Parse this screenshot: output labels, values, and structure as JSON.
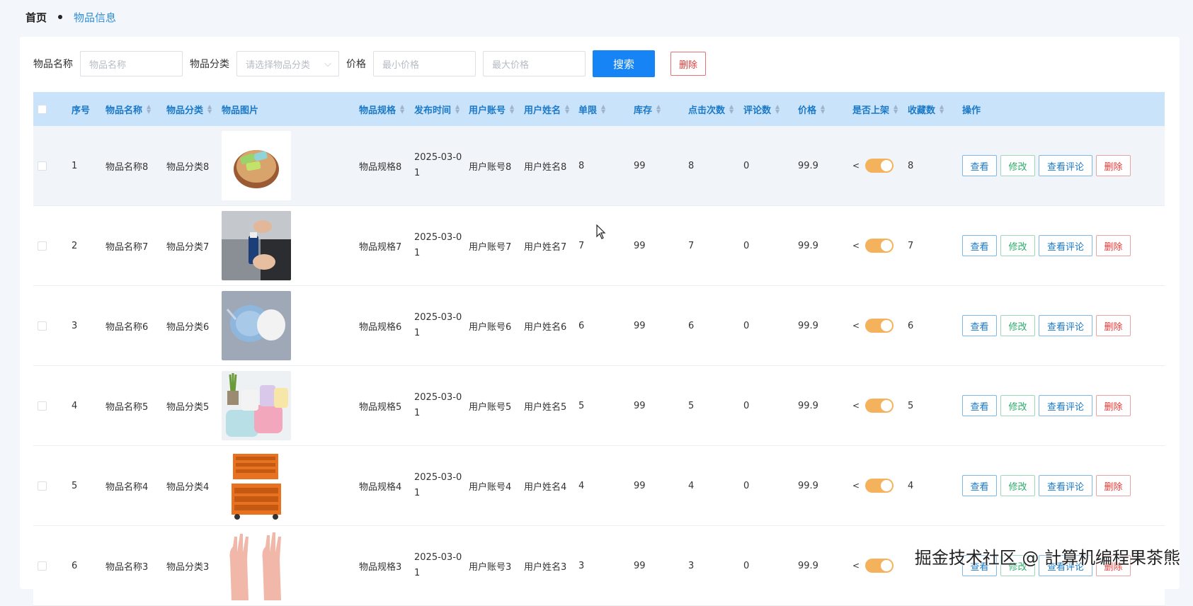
{
  "breadcrumb": {
    "home": "首页",
    "current": "物品信息"
  },
  "search": {
    "name_label": "物品名称",
    "name_placeholder": "物品名称",
    "category_label": "物品分类",
    "category_placeholder": "请选择物品分类",
    "price_label": "价格",
    "min_placeholder": "最小价格",
    "max_placeholder": "最大价格",
    "search_button": "搜索",
    "delete_button": "删除"
  },
  "table": {
    "headers": {
      "index": "序号",
      "name": "物品名称",
      "category": "物品分类",
      "image": "物品图片",
      "spec": "物品规格",
      "publish_time": "发布时间",
      "account": "用户账号",
      "username": "用户姓名",
      "limit": "单限",
      "stock": "库存",
      "clicks": "点击次数",
      "comments": "评论数",
      "price": "价格",
      "on_sale": "是否上架",
      "favorites": "收藏数",
      "actions": "操作"
    },
    "actions": {
      "view": "查看",
      "edit": "修改",
      "review": "查看评论",
      "delete": "删除"
    },
    "rows": [
      {
        "index": "1",
        "name": "物品名称8",
        "category": "物品分类8",
        "image": "wood-slice-soap",
        "spec": "物品规格8",
        "date_a": "2025-03-0",
        "date_b": "1",
        "account": "用户账号8",
        "username": "用户姓名8",
        "limit": "8",
        "stock": "99",
        "clicks": "8",
        "comments": "0",
        "price": "99.9",
        "on_sale": true,
        "favorites": "8"
      },
      {
        "index": "2",
        "name": "物品名称7",
        "category": "物品分类7",
        "image": "car-cleaning",
        "spec": "物品规格7",
        "date_a": "2025-03-0",
        "date_b": "1",
        "account": "用户账号7",
        "username": "用户姓名7",
        "limit": "7",
        "stock": "99",
        "clicks": "7",
        "comments": "0",
        "price": "99.9",
        "on_sale": true,
        "favorites": "7"
      },
      {
        "index": "3",
        "name": "物品名称6",
        "category": "物品分类6",
        "image": "face-masks",
        "spec": "物品规格6",
        "date_a": "2025-03-0",
        "date_b": "1",
        "account": "用户账号6",
        "username": "用户姓名6",
        "limit": "6",
        "stock": "99",
        "clicks": "6",
        "comments": "0",
        "price": "99.9",
        "on_sale": true,
        "favorites": "6"
      },
      {
        "index": "4",
        "name": "物品名称5",
        "category": "物品分类5",
        "image": "towels",
        "spec": "物品规格5",
        "date_a": "2025-03-0",
        "date_b": "1",
        "account": "用户账号5",
        "username": "用户姓名5",
        "limit": "5",
        "stock": "99",
        "clicks": "5",
        "comments": "0",
        "price": "99.9",
        "on_sale": true,
        "favorites": "5"
      },
      {
        "index": "5",
        "name": "物品名称4",
        "category": "物品分类4",
        "image": "tool-cabinet",
        "spec": "物品规格4",
        "date_a": "2025-03-0",
        "date_b": "1",
        "account": "用户账号4",
        "username": "用户姓名4",
        "limit": "4",
        "stock": "99",
        "clicks": "4",
        "comments": "0",
        "price": "99.9",
        "on_sale": true,
        "favorites": "4"
      },
      {
        "index": "6",
        "name": "物品名称3",
        "category": "物品分类3",
        "image": "rubber-gloves",
        "spec": "物品规格3",
        "date_a": "2025-03-0",
        "date_b": "1",
        "account": "用户账号3",
        "username": "用户姓名3",
        "limit": "3",
        "stock": "99",
        "clicks": "3",
        "comments": "0",
        "price": "99.9",
        "on_sale": true,
        "favorites": ""
      }
    ]
  },
  "watermark": "掘金技术社区 @ 計算机编程果茶熊",
  "colors": {
    "primary": "#1684f4",
    "header_bg": "#c9e3fb",
    "toggle_on": "#f5b25c",
    "danger": "#e53935",
    "success": "#2bab68"
  }
}
